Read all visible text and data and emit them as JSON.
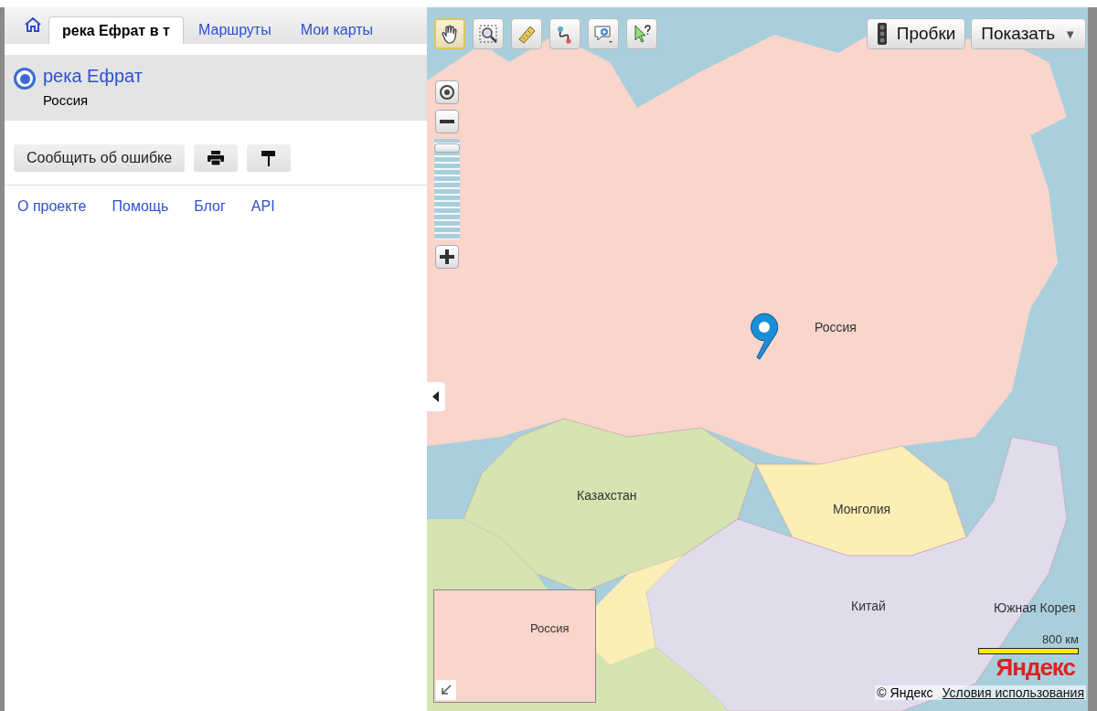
{
  "tabs": [
    {
      "label": "река Ефрат в т",
      "selected": true
    },
    {
      "label": "Маршруты",
      "selected": false
    },
    {
      "label": "Мои карты",
      "selected": false
    }
  ],
  "result": {
    "title": "река Ефрат",
    "subtitle": "Россия",
    "selected": true
  },
  "actions": {
    "report_button": "Сообщить об ошибке"
  },
  "footer_links": [
    "О проекте",
    "Помощь",
    "Блог",
    "API"
  ],
  "map_tools": [
    {
      "selected": true
    },
    {
      "selected": false
    },
    {
      "selected": false
    },
    {
      "selected": false
    },
    {
      "selected": false
    },
    {
      "selected": false
    }
  ],
  "map_buttons": {
    "traffic": "Пробки",
    "show": "Показать",
    "show_caret": "▼"
  },
  "zoom": {
    "level": 0.05
  },
  "map_labels": {
    "russia": "Россия",
    "kazakhstan": "Казахстан",
    "mongolia": "Монголия",
    "china": "Китай",
    "korea": "Южная Корея"
  },
  "minimap": {
    "label": "Россия"
  },
  "scale": {
    "label": "800 км"
  },
  "logo": "Яндекс",
  "copyright": "© Яндекс",
  "terms_link": "Условия использования"
}
